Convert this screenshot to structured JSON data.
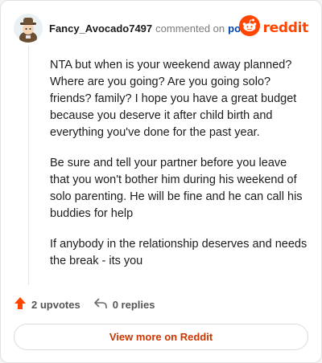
{
  "comment": {
    "username": "Fancy_Avocado7497",
    "action_text": "commented on",
    "post_link_label": "post",
    "paragraphs": [
      "NTA but when is your weekend away planned? Where are you going? Are you going solo? friends? family? I hope you have a great budget because you deserve it after child birth and everything you've done for the past year.",
      "Be sure and tell your partner before you leave that you won't bother him during his weekend of solo parenting. He will be fine and he can call his buddies for help",
      "If anybody in the relationship deserves and needs the break - its you"
    ]
  },
  "brand": {
    "wordmark": "reddit",
    "color": "#ff4500"
  },
  "actions": {
    "upvotes_label": "2 upvotes",
    "replies_label": "0 replies"
  },
  "footer": {
    "view_more_label": "View more on Reddit"
  },
  "icons": {
    "avatar": "avatar-icon",
    "logo": "reddit-logo-icon",
    "upvote": "upvote-arrow-icon",
    "reply": "reply-arrow-icon"
  }
}
